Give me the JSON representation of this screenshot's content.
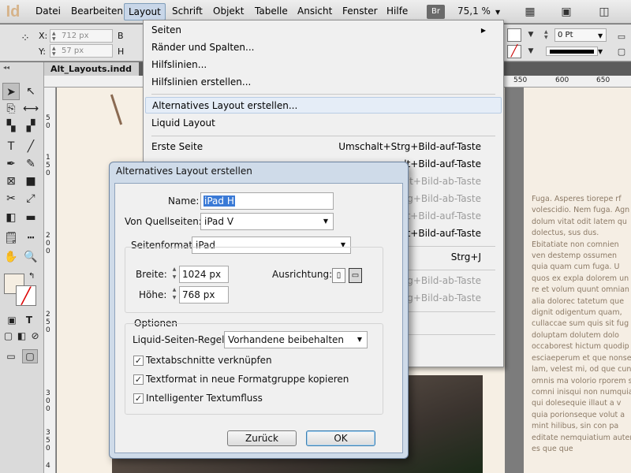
{
  "app": {
    "logo": "Id"
  },
  "menubar": {
    "items": [
      "Datei",
      "Bearbeiten",
      "Layout",
      "Schrift",
      "Objekt",
      "Tabelle",
      "Ansicht",
      "Fenster",
      "Hilfe"
    ],
    "bridge": "Br",
    "zoom": "75,1 %"
  },
  "control": {
    "x_label": "X:",
    "x_value": "712 px",
    "y_label": "Y:",
    "y_value": "57 px",
    "w_label": "B",
    "h_label": "H",
    "stroke_value": "0 Pt"
  },
  "document": {
    "tab": "Alt_Layouts.indd",
    "ruler_top": [
      "550",
      "600",
      "650"
    ],
    "ruler_left": [
      "5",
      "0",
      "1",
      "5",
      "0",
      "2",
      "0",
      "0",
      "2",
      "5",
      "0",
      "3",
      "0",
      "0",
      "3",
      "5",
      "0",
      "4"
    ],
    "right_column_text": "Fuga. Asperes tiorepe rf\nvolescidio. Nem fuga. Agn\ndolum vitat odit latem qu\ndolectus, sus dus.\nEbitatiate non comnien\nven destemp ossumen\nquia quam cum fuga. U\nquos ex expla dolorem un\nre et volum quunt omnian\nalia dolorec tatetum que\ndignit odigentum quam,\ncullaccae sum quis sit fug\ndoluptam dolutem dolo\noccaborest hictum quodip\nesciaeperum et que nonse\nlam, velest mi, od que cun\nomnis ma volorio rporem s\ncomni inisqui non numquia\nqui dolesequie illaut a v\nquia porionseque volut a\nmint hilibus, sin con pa\neditate nemquiatium auter\nes que que"
  },
  "layout_menu": {
    "items": [
      {
        "label": "Seiten",
        "shortcut": "",
        "disabled": false,
        "submenu": true
      },
      {
        "label": "Ränder und Spalten...",
        "shortcut": "",
        "disabled": false
      },
      {
        "label": "Hilfslinien...",
        "shortcut": "",
        "disabled": false
      },
      {
        "label": "Hilfslinien erstellen...",
        "shortcut": "",
        "disabled": false
      },
      {
        "label": "Alternatives Layout erstellen...",
        "shortcut": "",
        "disabled": false,
        "highlighted": true
      },
      {
        "label": "Liquid Layout",
        "shortcut": "",
        "disabled": false
      },
      {
        "label": "Erste Seite",
        "shortcut": "Umschalt+Strg+Bild-auf-Taste",
        "disabled": false
      },
      {
        "label": "",
        "shortcut": "alt+Bild-auf-Taste",
        "disabled": false
      },
      {
        "label": "",
        "shortcut": "chalt+Bild-ab-Taste",
        "disabled": true
      },
      {
        "label": "",
        "shortcut": "Strg+Bild-ab-Taste",
        "disabled": true
      },
      {
        "label": "",
        "shortcut": "Alt+Bild-auf-Taste",
        "disabled": true
      },
      {
        "label": "",
        "shortcut": "Alt+Bild-auf-Taste",
        "disabled": false
      },
      {
        "label": "",
        "shortcut": "Strg+J",
        "disabled": false
      },
      {
        "label": "",
        "shortcut": "Strg+Bild-ab-Taste",
        "disabled": true
      },
      {
        "label": "",
        "shortcut": "Strg+Bild-ab-Taste",
        "disabled": true
      }
    ]
  },
  "dialog": {
    "title": "Alternatives Layout erstellen",
    "name_label": "Name:",
    "name_value": "iPad H",
    "source_label": "Von Quellseiten:",
    "source_value": "iPad V",
    "format_label": "Seitenformat:",
    "format_value": "iPad",
    "width_label": "Breite:",
    "width_value": "1024 px",
    "height_label": "Höhe:",
    "height_value": "768 px",
    "orientation_label": "Ausrichtung:",
    "options_label": "Optionen",
    "liquid_label": "Liquid-Seiten-Regel:",
    "liquid_value": "Vorhandene beibehalten",
    "checkboxes": [
      "Textabschnitte verknüpfen",
      "Textformat in neue Formatgruppe kopieren",
      "Intelligenter Textumfluss"
    ],
    "cancel": "Zurück",
    "ok": "OK"
  }
}
